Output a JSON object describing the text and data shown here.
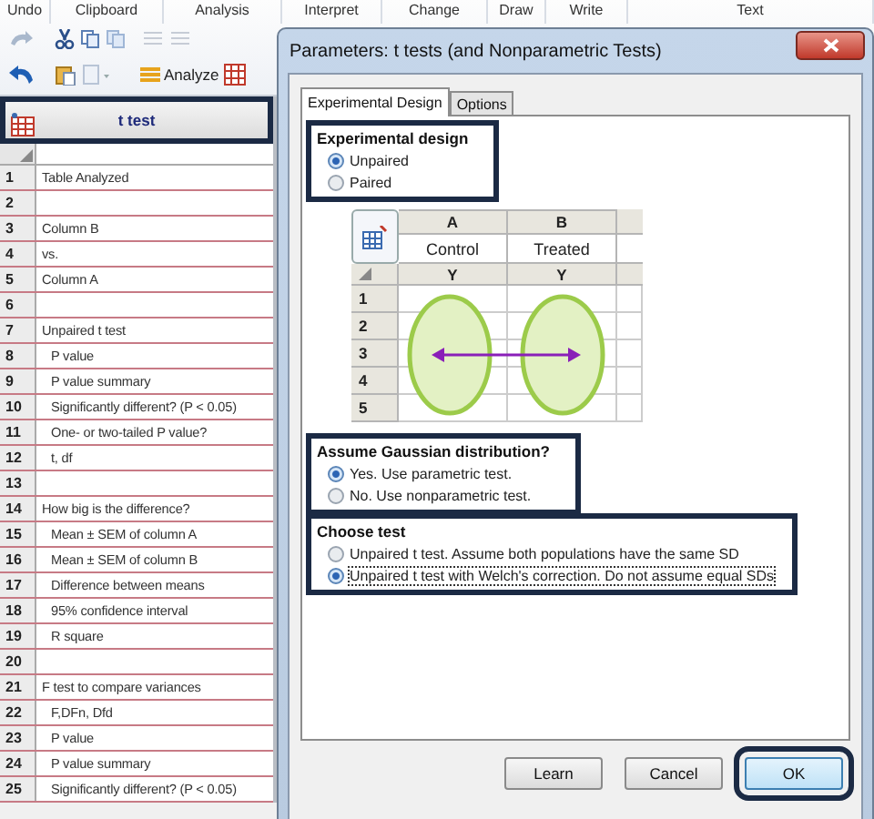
{
  "ribbon": {
    "groups": [
      {
        "label": "Undo"
      },
      {
        "label": "Clipboard"
      },
      {
        "label": "Analysis"
      },
      {
        "label": "Interpret"
      },
      {
        "label": "Change"
      },
      {
        "label": "Draw"
      },
      {
        "label": "Write"
      },
      {
        "label": "Text"
      }
    ],
    "analyze_button": "Analyze"
  },
  "sheet": {
    "title": "t test",
    "highlighted": true,
    "rows": [
      {
        "number": "1",
        "text": "Table Analyzed"
      },
      {
        "number": "2"
      },
      {
        "number": "3",
        "text": "Column B"
      },
      {
        "number": "4",
        "text": "vs."
      },
      {
        "number": "5",
        "text": "Column A"
      },
      {
        "number": "6"
      },
      {
        "number": "7",
        "text": "Unpaired t test",
        "children": [
          {
            "number": "8",
            "text": "P value"
          },
          {
            "number": "9",
            "text": "P value summary"
          },
          {
            "number": "10",
            "text": "Significantly different? (P < 0.05)"
          },
          {
            "number": "11",
            "text": "One- or two-tailed P value?"
          },
          {
            "number": "12",
            "text": "t, df"
          }
        ]
      },
      {
        "number": "13"
      },
      {
        "number": "14",
        "text": "How big is the difference?",
        "children": [
          {
            "number": "15",
            "text": "Mean ± SEM of column A"
          },
          {
            "number": "16",
            "text": "Mean ± SEM of column B"
          },
          {
            "number": "17",
            "text": "Difference between means"
          },
          {
            "number": "18",
            "text": "95% confidence interval"
          },
          {
            "number": "19",
            "text": "R square"
          }
        ]
      },
      {
        "number": "20"
      },
      {
        "number": "21",
        "text": "F test to compare variances",
        "children": [
          {
            "number": "22",
            "text": "F,DFn, Dfd"
          },
          {
            "number": "23",
            "text": "P value"
          },
          {
            "number": "24",
            "text": "P value summary"
          },
          {
            "number": "25",
            "text": "Significantly different? (P < 0.05)"
          }
        ]
      }
    ]
  },
  "dialog": {
    "title": "Parameters: t tests (and Nonparametric Tests)",
    "tabs": [
      {
        "label": "Experimental Design",
        "selected": true
      },
      {
        "label": "Options",
        "selected": false
      }
    ],
    "sections": [
      {
        "title": "Experimental design",
        "highlighted": true,
        "options": [
          {
            "label": "Unpaired",
            "selected": true
          },
          {
            "label": "Paired",
            "selected": false
          }
        ]
      },
      {
        "title": "Assume Gaussian distribution?",
        "highlighted": true,
        "options": [
          {
            "label": "Yes. Use parametric test.",
            "selected": true
          },
          {
            "label": "No. Use nonparametric test.",
            "selected": false
          }
        ]
      },
      {
        "title": "Choose test",
        "highlighted": true,
        "options": [
          {
            "label": "Unpaired t test. Assume both populations have the same SD",
            "selected": false
          },
          {
            "label": "Unpaired t test with Welch's correction. Do not assume equal SDs",
            "selected": true
          }
        ]
      }
    ],
    "diagram": {
      "columns": [
        {
          "letter": "A",
          "title": "Control",
          "subtitle": "Y"
        },
        {
          "letter": "B",
          "title": "Treated",
          "subtitle": "Y"
        }
      ],
      "rows": [
        "1",
        "2",
        "3",
        "4",
        "5"
      ]
    },
    "buttons": [
      {
        "label": "Learn",
        "highlighted": false
      },
      {
        "label": "Cancel",
        "highlighted": false
      },
      {
        "label": "OK",
        "highlighted": true
      }
    ]
  }
}
